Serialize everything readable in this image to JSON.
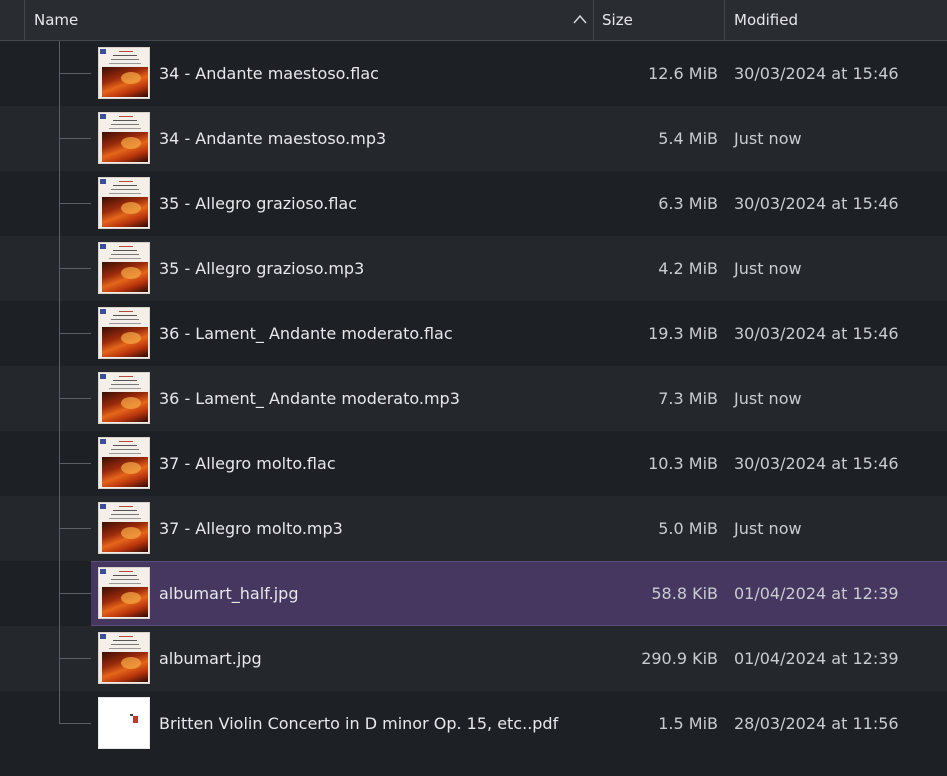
{
  "header": {
    "name_label": "Name",
    "size_label": "Size",
    "modified_label": "Modified",
    "sort_indicator": "chevron-up-icon"
  },
  "files": [
    {
      "name": "34 - Andante maestoso.flac",
      "size": "12.6 MiB",
      "modified": "30/03/2024 at 15:46",
      "thumb": "album-art",
      "selected": false
    },
    {
      "name": "34 - Andante maestoso.mp3",
      "size": "5.4 MiB",
      "modified": "Just now",
      "thumb": "album-art",
      "selected": false
    },
    {
      "name": "35 - Allegro grazioso.flac",
      "size": "6.3 MiB",
      "modified": "30/03/2024 at 15:46",
      "thumb": "album-art",
      "selected": false
    },
    {
      "name": "35 - Allegro grazioso.mp3",
      "size": "4.2 MiB",
      "modified": "Just now",
      "thumb": "album-art",
      "selected": false
    },
    {
      "name": "36 - Lament_ Andante moderato.flac",
      "size": "19.3 MiB",
      "modified": "30/03/2024 at 15:46",
      "thumb": "album-art",
      "selected": false
    },
    {
      "name": "36 - Lament_ Andante moderato.mp3",
      "size": "7.3 MiB",
      "modified": "Just now",
      "thumb": "album-art",
      "selected": false
    },
    {
      "name": "37 - Allegro molto.flac",
      "size": "10.3 MiB",
      "modified": "30/03/2024 at 15:46",
      "thumb": "album-art",
      "selected": false
    },
    {
      "name": "37 - Allegro molto.mp3",
      "size": "5.0 MiB",
      "modified": "Just now",
      "thumb": "album-art",
      "selected": false
    },
    {
      "name": "albumart_half.jpg",
      "size": "58.8 KiB",
      "modified": "01/04/2024 at 12:39",
      "thumb": "album-art",
      "selected": true
    },
    {
      "name": "albumart.jpg",
      "size": "290.9 KiB",
      "modified": "01/04/2024 at 12:39",
      "thumb": "album-art",
      "selected": false
    },
    {
      "name": "Britten Violin Concerto in D minor Op. 15, etc..pdf",
      "size": "1.5 MiB",
      "modified": "28/03/2024 at 11:56",
      "thumb": "pdf-page",
      "selected": false
    }
  ],
  "colors": {
    "background": "#1d2125",
    "alt_row": "#24282d",
    "selection": "#453760",
    "header": "#292d32"
  }
}
